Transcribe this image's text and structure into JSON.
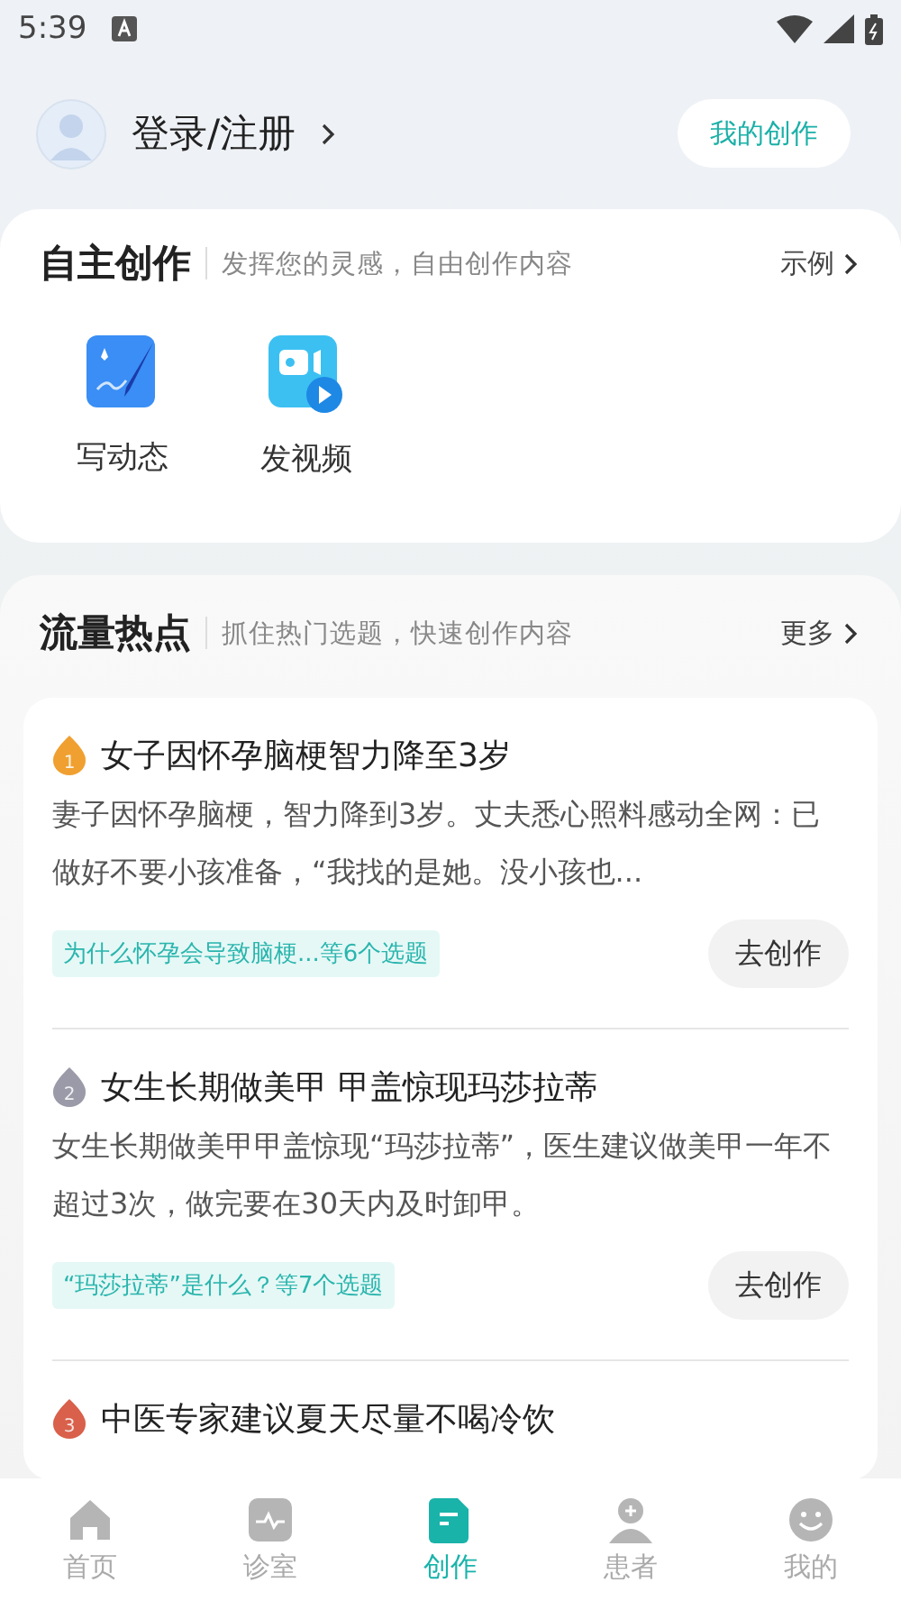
{
  "status_bar": {
    "time": "5:39"
  },
  "header": {
    "login": "登录/注册",
    "my_creations": "我的创作"
  },
  "self_creation": {
    "title": "自主创作",
    "subtitle": "发挥您的灵感，自由创作内容",
    "link": "示例",
    "actions": [
      {
        "label": "写动态",
        "kind": "post"
      },
      {
        "label": "发视频",
        "kind": "video"
      }
    ]
  },
  "hot_topics": {
    "title": "流量热点",
    "subtitle": "抓住热门选题，快速创作内容",
    "link": "更多",
    "items": [
      {
        "rank": "1",
        "color": "#f0a030",
        "title": "女子因怀孕脑梗智力降至3岁",
        "summary": "妻子因怀孕脑梗，智力降到3岁。丈夫悉心照料感动全网：已做好不要小孩准备，“我找的是她。没小孩也...",
        "tag": "为什么怀孕会导致脑梗...等6个选题",
        "button": "去创作"
      },
      {
        "rank": "2",
        "color": "#9a9aa8",
        "title": "女生长期做美甲 甲盖惊现玛莎拉蒂",
        "summary": "女生长期做美甲甲盖惊现“玛莎拉蒂”，医生建议做美甲一年不超过3次，做完要在30天内及时卸甲。",
        "tag": "“玛莎拉蒂”是什么？等7个选题",
        "button": "去创作"
      },
      {
        "rank": "3",
        "color": "#d9604a",
        "title": "中医专家建议夏天尽量不喝冷饮"
      }
    ]
  },
  "bottom_nav": [
    {
      "label": "首页",
      "kind": "home",
      "selected": false
    },
    {
      "label": "诊室",
      "kind": "clinic",
      "selected": false
    },
    {
      "label": "创作",
      "kind": "create",
      "selected": true
    },
    {
      "label": "患者",
      "kind": "patient",
      "selected": false
    },
    {
      "label": "我的",
      "kind": "me",
      "selected": false
    }
  ]
}
